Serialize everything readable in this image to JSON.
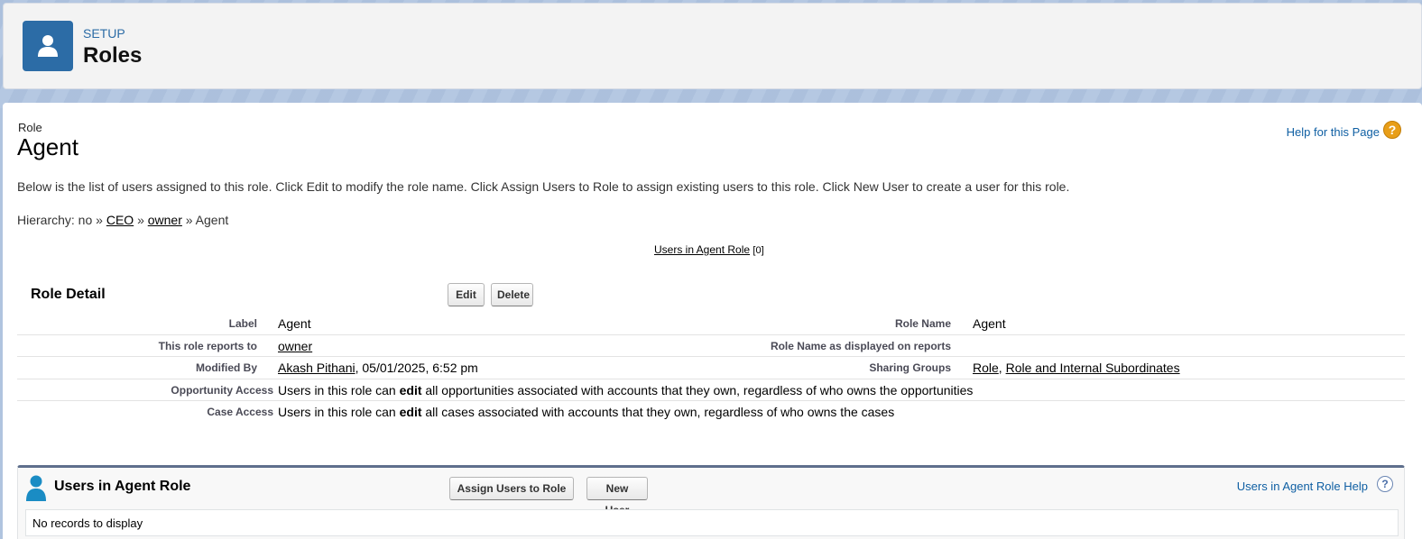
{
  "header": {
    "eyebrow": "SETUP",
    "title": "Roles",
    "icon": "user-icon",
    "icon_color": "#2c6ca6"
  },
  "page": {
    "entity_type": "Role",
    "entity_name": "Agent",
    "help_link": "Help for this Page",
    "description": "Below is the list of users assigned to this role. Click Edit to modify the role name. Click Assign Users to Role to assign existing users to this role. Click New User to create a user for this role.",
    "hierarchy": {
      "prefix": "Hierarchy: no »",
      "items": [
        "CEO",
        "owner"
      ],
      "separator": "»",
      "current": "» Agent"
    },
    "related_link": {
      "label": "Users in Agent Role",
      "count": "[0]"
    }
  },
  "detail": {
    "title": "Role Detail",
    "edit_label": "Edit",
    "delete_label": "Delete",
    "rows": [
      {
        "label": "Label",
        "value": "Agent",
        "label2": "Role Name",
        "value2": "Agent"
      },
      {
        "label": "This role reports to",
        "value_link": "owner",
        "label2": "Role Name as displayed on reports",
        "value2": ""
      },
      {
        "label": "Modified By",
        "value_link": "Akash Pithani",
        "value_suffix": ", 05/01/2025, 6:52 pm",
        "label2": "Sharing Groups",
        "links2": [
          "Role",
          "Role and Internal Subordinates"
        ]
      },
      {
        "label": "Opportunity Access",
        "value_pre": "Users in this role can",
        "value_bold": "edit",
        "value_post": "all opportunities associated with accounts that they own, regardless of who owns the opportunities"
      },
      {
        "label": "Case Access",
        "value_pre": "Users in this role can",
        "value_bold": "edit",
        "value_post": "all cases associated with accounts that they own, regardless of who owns the cases"
      }
    ]
  },
  "related_list": {
    "title": "Users in Agent Role",
    "assign_label": "Assign Users to Role",
    "new_user_label": "New User",
    "help_label": "Users in Agent Role Help",
    "empty_text": "No records to display",
    "icon": "person-icon",
    "icon_color": "#1a8cc4"
  }
}
